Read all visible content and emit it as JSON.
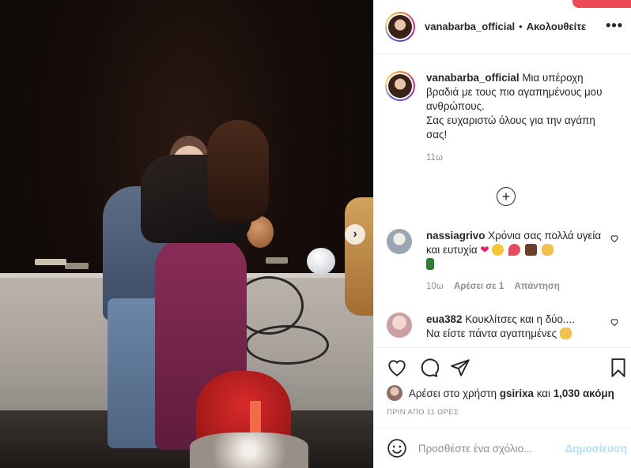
{
  "header": {
    "username": "vanabarba_official",
    "separator": "•",
    "follow_label": "Ακολουθείτε",
    "more_icon": "more-horizontal-icon"
  },
  "caption": {
    "username": "vanabarba_official",
    "text": "Μια υπέροχη βραδιά με τους πιο αγαπημένους μου ανθρώπους.",
    "text2": "Σας ευχαριστώ όλους για την αγάπη σας!",
    "time": "11ω"
  },
  "load_more_icon": "plus-circle-icon",
  "comments": [
    {
      "username": "nassiagrivo",
      "text": "Χρόνια σας πολλά υγεία και ευτυχία",
      "time": "10ω",
      "likes": "Αρέσει σε 1",
      "reply": "Απάντηση"
    },
    {
      "username": "eua382",
      "text": "Κουκλίτσες και η δύο....",
      "text2": "Να είστε πάντα αγαπημένες"
    }
  ],
  "likes": {
    "prefix": "Αρέσει στο χρήστη",
    "user": "gsirixa",
    "conj": "και",
    "count": "1,030 ακόμη"
  },
  "post_time": "ΠΡΙΝ ΑΠΟ 11 ΩΡΕΣ",
  "add_comment": {
    "placeholder": "Προσθέστε ένα σχόλιο...",
    "post_label": "Δημοσίευση"
  },
  "colors": {
    "accent_red": "#ed4956",
    "post_disabled": "#b2dffc",
    "muted": "#8e8e8e"
  }
}
